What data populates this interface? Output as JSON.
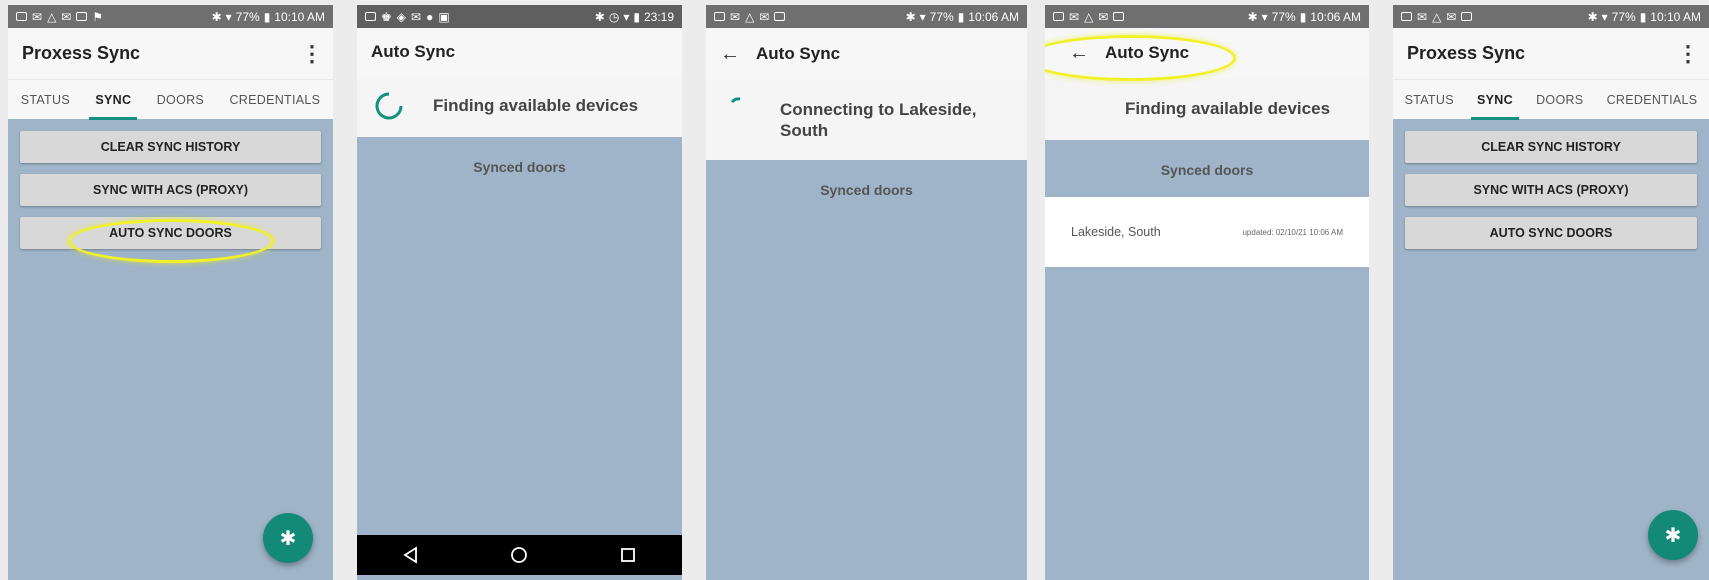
{
  "colors": {
    "accent": "#129181",
    "content_bg": "#9fb4c8",
    "status_bar": "#6f6f6f",
    "highlight": "#f1f12a",
    "fab": "#138978"
  },
  "panels": [
    {
      "status_time": "10:10 AM",
      "battery": "77%",
      "title": "Proxess Sync",
      "menu_icon": "more-vert-icon",
      "tabs": [
        "STATUS",
        "SYNC",
        "DOORS",
        "CREDENTIALS"
      ],
      "active_tab": "SYNC",
      "buttons": [
        "CLEAR SYNC HISTORY",
        "SYNC WITH ACS (PROXY)",
        "AUTO SYNC DOORS"
      ],
      "highlighted_button": "AUTO SYNC DOORS",
      "fab_icon": "bluetooth-icon"
    },
    {
      "status_time": "23:19",
      "title": "Auto Sync",
      "status_message": "Finding available devices",
      "synced_label": "Synced doors",
      "nav_icons": [
        "back-triangle-icon",
        "home-circle-icon",
        "recents-square-icon"
      ]
    },
    {
      "status_time": "10:06 AM",
      "battery": "77%",
      "title": "Auto Sync",
      "status_message": "Connecting to Lakeside, South",
      "synced_label": "Synced doors"
    },
    {
      "status_time": "10:06 AM",
      "battery": "77%",
      "title": "Auto Sync",
      "status_message": "Finding available devices",
      "synced_label": "Synced doors",
      "devices": [
        {
          "name": "Lakeside, South",
          "updated": "updated: 02/10/21 10:06 AM"
        }
      ]
    },
    {
      "status_time": "10:10 AM",
      "battery": "77%",
      "title": "Proxess Sync",
      "menu_icon": "more-vert-icon",
      "tabs": [
        "STATUS",
        "SYNC",
        "DOORS",
        "CREDENTIALS"
      ],
      "active_tab": "SYNC",
      "buttons": [
        "CLEAR SYNC HISTORY",
        "SYNC WITH ACS (PROXY)",
        "AUTO SYNC DOORS"
      ],
      "fab_icon": "bluetooth-icon"
    }
  ]
}
